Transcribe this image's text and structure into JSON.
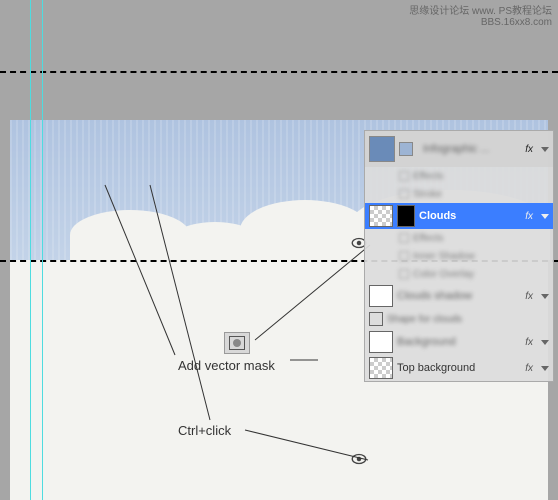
{
  "watermark": {
    "line1": "思缘设计论坛  www.  PS教程论坛",
    "line2": "BBS.16xx8.com"
  },
  "annotations": {
    "add_vector_mask": "Add vector mask",
    "ctrl_click": "Ctrl+click"
  },
  "layers": {
    "group_name": "Infographic ...",
    "effects_label": "Effects",
    "stroke_label": "Stroke",
    "clouds": "Clouds",
    "inner_shadow": "Inner Shadow",
    "color_overlay": "Color Overlay",
    "clouds_shadow": "Clouds shadow",
    "shape_for_clouds": "Shape for clouds",
    "background": "Background",
    "top_background": "Top background",
    "fx": "fx"
  }
}
